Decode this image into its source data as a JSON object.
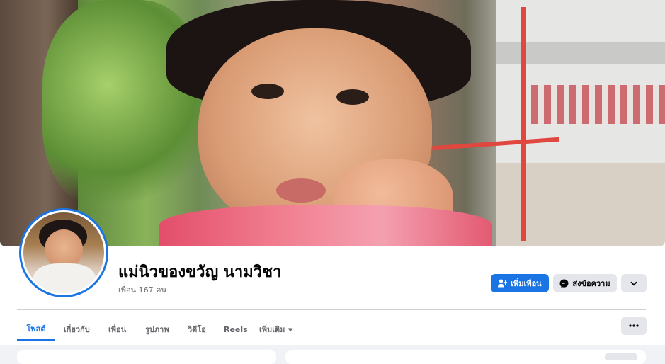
{
  "profile": {
    "name": "แม่นิวของขวัญ นามวิชา",
    "friends_count": "เพื่อน 167 คน"
  },
  "actions": {
    "add_friend": "เพิ่มเพื่อน",
    "message": "ส่งข้อความ"
  },
  "tabs": [
    {
      "label": "โพสต์",
      "active": true
    },
    {
      "label": "เกี่ยวกับ",
      "active": false
    },
    {
      "label": "เพื่อน",
      "active": false
    },
    {
      "label": "รูปภาพ",
      "active": false
    },
    {
      "label": "วิดีโอ",
      "active": false
    },
    {
      "label": "Reels",
      "active": false
    },
    {
      "label": "เพิ่มเติม",
      "active": false
    }
  ],
  "colors": {
    "accent": "#1b74e4",
    "page_bg": "#f0f2f5",
    "secondary_button": "#e4e6eb",
    "muted_text": "#65676b"
  },
  "icons": {
    "add_friend": "person-plus-icon",
    "message": "messenger-icon",
    "dropdown": "chevron-down-icon",
    "more": "ellipsis-icon",
    "tab_dropdown": "caret-down-icon"
  }
}
